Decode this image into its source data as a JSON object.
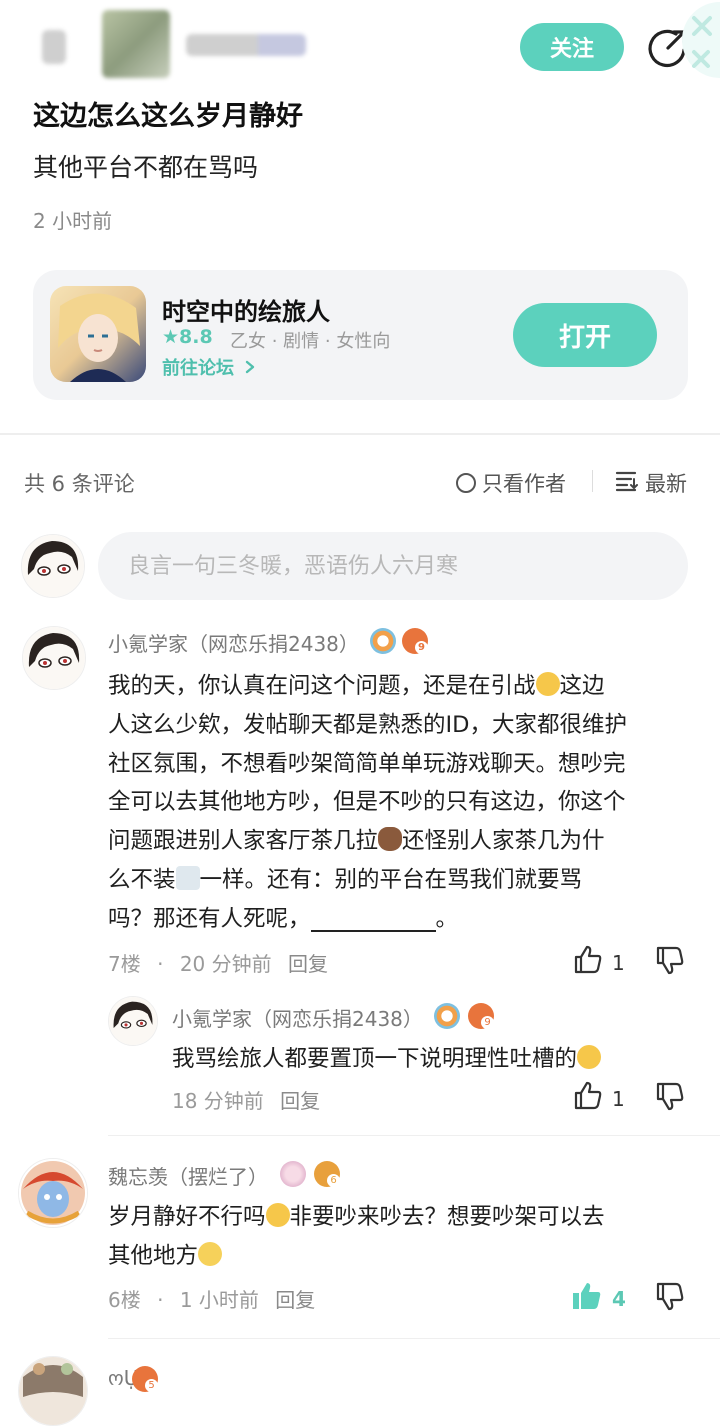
{
  "header": {
    "follow_label": "关注"
  },
  "post": {
    "title": "这边怎么这么岁月静好",
    "body": "其他平台不都在骂吗",
    "time": "2 小时前"
  },
  "game_card": {
    "name": "时空中的绘旅人",
    "rating": "8.8",
    "tags": "乙女 · 剧情 · 女性向",
    "forum_link": "前往论坛",
    "open_label": "打开"
  },
  "comments_header": {
    "count": "共 6 条评论",
    "author_only": "只看作者",
    "sort": "最新"
  },
  "comment_input": {
    "placeholder": "良言一句三冬暖，恶语伤人六月寒"
  },
  "comments": [
    {
      "name": "小氪学家（网恋乐捐2438）",
      "badge_level": "9",
      "lines": [
        "我的天，你认真在问这个问题，还是在引战",
        "这边",
        "人这么少欸，发帖聊天都是熟悉的ID，大家都很维护",
        "社区氛围，不想看吵架简简单单玩游戏聊天。想吵完",
        "全可以去其他地方吵，但是不吵的只有这边，你这个",
        "问题跟进别人家客厅茶几拉",
        "还怪别人家茶几为什",
        "么不装",
        "一样。还有：别的平台在骂我们就要骂",
        "吗？那还有人死呢，",
        "。"
      ],
      "floor": "7楼",
      "time": "20 分钟前",
      "reply_label": "回复",
      "likes": "1"
    },
    {
      "name": "小氪学家（网恋乐捐2438）",
      "badge_level": "9",
      "text": "我骂绘旅人都要置顶一下说明理性吐槽的",
      "time": "18 分钟前",
      "reply_label": "回复",
      "likes": "1"
    },
    {
      "name": "魏忘羡（摆烂了）",
      "badge_level": "6",
      "line1a": "岁月静好不行吗",
      "line1b": "非要吵来吵去？想要吵架可以去",
      "line2": "其他地方",
      "floor": "6楼",
      "time": "1 小时前",
      "reply_label": "回复",
      "likes": "4"
    },
    {
      "name": "ოỤ",
      "badge_level": "5"
    }
  ],
  "colors": {
    "accent": "#5cd1bd",
    "accent_text": "#4fbfad",
    "badge_orange": "#e8743c"
  }
}
